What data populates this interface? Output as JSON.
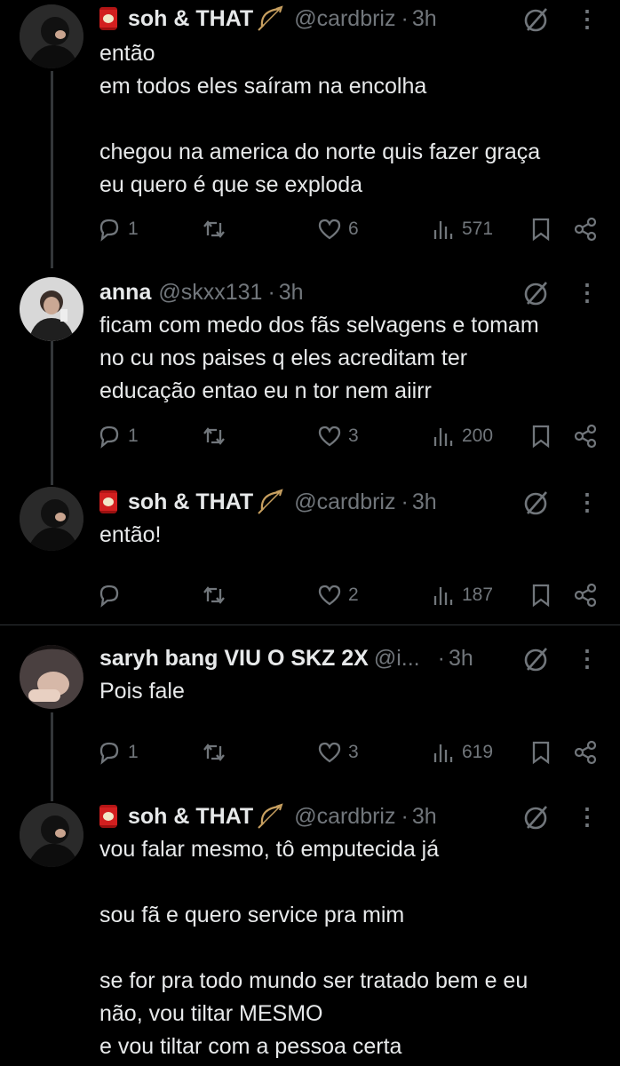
{
  "tweets": [
    {
      "name": "soh & THAT",
      "handle": "@cardbriz",
      "time": "3h",
      "text": "então\nem todos eles saíram na encolha\n\nchegou na america do norte quis fazer graça\neu quero é que se exploda",
      "replies": "1",
      "likes": "6",
      "views": "571"
    },
    {
      "name": "anna",
      "handle": "@skxx131",
      "time": "3h",
      "text": "ficam com medo dos fãs selvagens e tomam\nno cu nos paises q eles acreditam ter\neducação entao eu n tor nem aiirr",
      "replies": "1",
      "likes": "3",
      "views": "200"
    },
    {
      "name": "soh & THAT",
      "handle": "@cardbriz",
      "time": "3h",
      "text": "então!",
      "replies": "",
      "likes": "2",
      "views": "187"
    },
    {
      "name": "saryh bang VIU O SKZ 2X",
      "handle": "@i...",
      "time": "3h",
      "text": "Pois fale",
      "replies": "1",
      "likes": "3",
      "views": "619"
    },
    {
      "name": "soh & THAT",
      "handle": "@cardbriz",
      "time": "3h",
      "text": "vou falar mesmo, tô emputecida já\n\nsou fã e quero service pra mim\n\nse for pra todo mundo ser tratado bem e eu\nnão, vou tiltar MESMO\ne vou tiltar com a pessoa certa",
      "replies": "",
      "likes": "",
      "views": ""
    }
  ],
  "separator": "·",
  "more_glyph": "⋮"
}
